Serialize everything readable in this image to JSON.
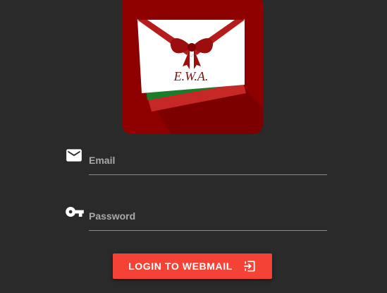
{
  "logo": {
    "text": "E.W.A.",
    "icon": "gift-envelope-icon"
  },
  "form": {
    "email": {
      "label": "Email",
      "value": "",
      "icon": "envelope-icon"
    },
    "password": {
      "label": "Password",
      "value": "",
      "icon": "key-icon"
    }
  },
  "login_button": {
    "label": "LOGIN TO WEBMAIL",
    "icon": "sign-in-icon"
  },
  "colors": {
    "background": "#2a2a2a",
    "logo_tile": "#8e0000",
    "accent": "#f44336",
    "envelope_green": "#1b7d2a",
    "envelope_red": "#c62828"
  }
}
